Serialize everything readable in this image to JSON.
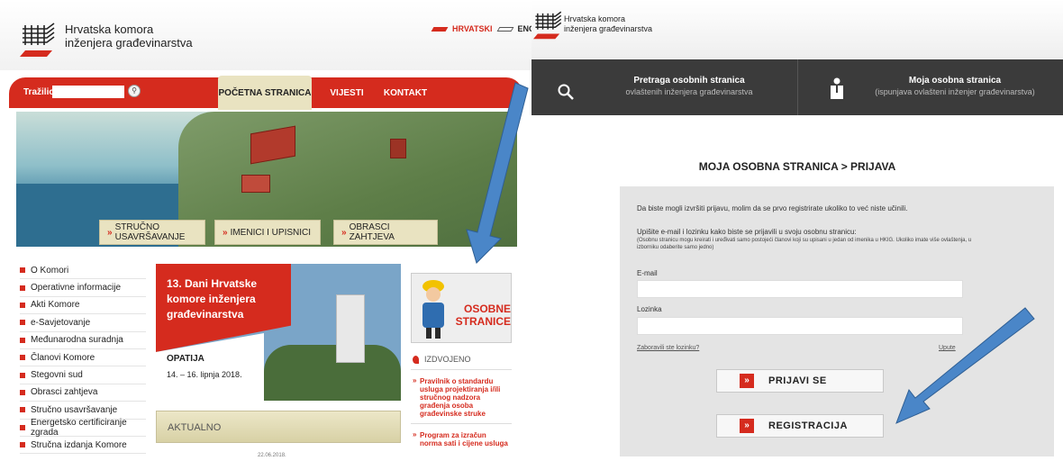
{
  "left": {
    "org_name_line1": "Hrvatska komora",
    "org_name_line2": "inženjera građevinarstva",
    "lang_hr": "HRVATSKI",
    "lang_en": "ENGLISH",
    "search_label": "Tražilica",
    "search_icon": "search-icon",
    "nav": {
      "home": "POČETNA STRANICA",
      "news": "VIJESTI",
      "contact": "KONTAKT"
    },
    "quick_links": [
      "STRUČNO USAVRŠAVANJE",
      "IMENICI I UPISNICI",
      "OBRASCI ZAHTJEVA"
    ],
    "sidebar": [
      "O Komori",
      "Operativne informacije",
      "Akti Komore",
      "e-Savjetovanje",
      "Međunarodna suradnja",
      "Članovi Komore",
      "Stegovni sud",
      "Obrasci zahtjeva",
      "Stručno usavršavanje",
      "Energetsko certificiranje zgrada",
      "Stručna izdanja Komore"
    ],
    "promo": {
      "title": "13. Dani Hrvatske komore inženjera građevinarstva",
      "city": "OPATIJA",
      "date": "14. – 16. lipnja 2018."
    },
    "aktualno": "AKTUALNO",
    "aktualno_date": "22.06.2018.",
    "osobne_line1": "OSOBNE",
    "osobne_line2": "STRANICE",
    "izdvojeno": "IZDVOJENO",
    "featured": [
      "Pravilnik o standardu usluga projektiranja i/ili stručnog nadzora građenja osoba građevinske struke",
      "Program za izračun norma sati i cijene usluga"
    ]
  },
  "right": {
    "org_name_line1": "Hrvatska komora",
    "org_name_line2": "inženjera građevinarstva",
    "bar": {
      "search_title": "Pretraga osobnih stranica",
      "search_sub": "ovlaštenih inženjera građevinarstva",
      "my_title": "Moja osobna stranica",
      "my_sub": "(ispunjava ovlašteni inženjer građevinarstva)"
    },
    "heading": "MOJA OSOBNA STRANICA > PRIJAVA",
    "intro": "Da biste mogli izvršiti prijavu, molim da se prvo registrirate ukoliko to već niste učinili.",
    "instruction": "Upišite e-mail i lozinku kako biste se prijavili u svoju osobnu stranicu:",
    "note": "(Osobnu stranicu mogu kreirati i uređivati samo postojeći članovi koji su upisani u jedan od imenika u HKIG. Ukoliko imate više ovlaštenja, u izborniku odaberite samo jedno)",
    "email_label": "E-mail",
    "email_value": "",
    "password_label": "Lozinka",
    "password_value": "",
    "forgot_link": "Zaboravili ste lozinku?",
    "help_link": "Upute",
    "login_button": "PRIJAVI SE",
    "register_button": "REGISTRACIJA",
    "button_icon": "»"
  },
  "accent_color": "#d52b1e",
  "arrow_color": "#4a86c8"
}
